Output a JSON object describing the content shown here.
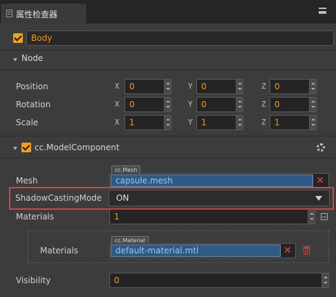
{
  "panel": {
    "title": "属性检查器"
  },
  "entity": {
    "name": "Body",
    "enabled": true
  },
  "node": {
    "section_title": "Node",
    "rows": [
      {
        "label": "Position",
        "x": "0",
        "y": "0",
        "z": "0"
      },
      {
        "label": "Rotation",
        "x": "0",
        "y": "0",
        "z": "0"
      },
      {
        "label": "Scale",
        "x": "1",
        "y": "1",
        "z": "1"
      }
    ],
    "axis_labels": {
      "x": "X",
      "y": "Y",
      "z": "Z"
    }
  },
  "component": {
    "title": "cc.ModelComponent",
    "enabled": true,
    "mesh": {
      "label": "Mesh",
      "type_tag": "cc.Mesh",
      "value": "capsule.mesh"
    },
    "shadow_casting_mode": {
      "label": "ShadowCastingMode",
      "value": "ON"
    },
    "materials": {
      "label": "Materials",
      "count": "1",
      "item": {
        "label": "Materials",
        "type_tag": "cc.Material",
        "value": "default-material.mtl"
      }
    },
    "visibility": {
      "label": "Visibility",
      "value": "0"
    }
  },
  "colors": {
    "accent": "#f39a1e",
    "highlight": "#e04040",
    "asset": "#2d5b86"
  }
}
